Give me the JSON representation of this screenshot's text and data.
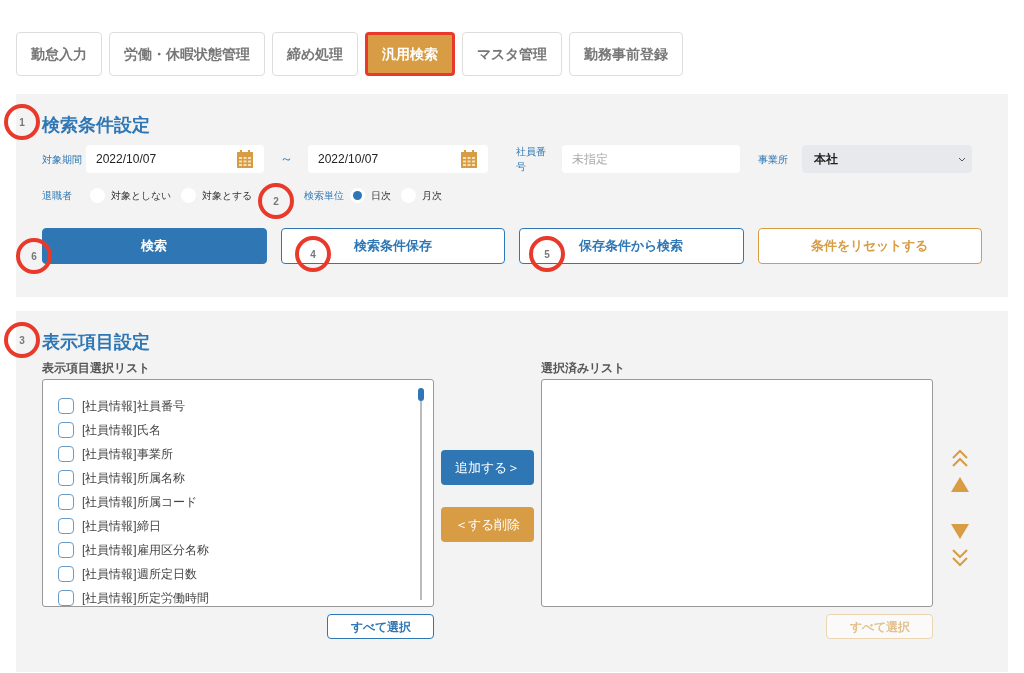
{
  "tabs": [
    {
      "label": "勤怠入力",
      "selected": false
    },
    {
      "label": "労働・休暇状態管理",
      "selected": false
    },
    {
      "label": "締め処理",
      "selected": false
    },
    {
      "label": "汎用検索",
      "selected": true
    },
    {
      "label": "マスタ管理",
      "selected": false
    },
    {
      "label": "勤務事前登録",
      "selected": false
    }
  ],
  "search_panel": {
    "title": "検索条件設定",
    "period_label": "対象期間",
    "date_from": "2022/10/07",
    "range_sep": "～",
    "date_to": "2022/10/07",
    "employee_no_label": "社員番号",
    "employee_no_placeholder": "未指定",
    "office_label": "事業所",
    "office_value": "本社",
    "retired_label": "退職者",
    "retired_options": [
      {
        "label": "対象としない",
        "selected": false
      },
      {
        "label": "対象とする",
        "selected": false
      }
    ],
    "unit_label": "検索単位",
    "unit_options": [
      {
        "label": "日次",
        "selected": true
      },
      {
        "label": "月次",
        "selected": false
      }
    ],
    "buttons": [
      {
        "kind": "primary",
        "label": "検索"
      },
      {
        "kind": "outline",
        "label": "検索条件保存"
      },
      {
        "kind": "outline",
        "label": "保存条件から検索"
      },
      {
        "kind": "reset",
        "label": "条件をリセットする"
      }
    ]
  },
  "display_panel": {
    "title": "表示項目設定",
    "available_title": "表示項目選択リスト",
    "available_items": [
      {
        "label": "[社員情報]社員番号",
        "checked": false
      },
      {
        "label": "[社員情報]氏名",
        "checked": false
      },
      {
        "label": "[社員情報]事業所",
        "checked": false
      },
      {
        "label": "[社員情報]所属名称",
        "checked": false
      },
      {
        "label": "[社員情報]所属コード",
        "checked": false
      },
      {
        "label": "[社員情報]締日",
        "checked": false
      },
      {
        "label": "[社員情報]雇用区分名称",
        "checked": false
      },
      {
        "label": "[社員情報]週所定日数",
        "checked": false
      },
      {
        "label": "[社員情報]所定労働時間",
        "checked": false
      }
    ],
    "select_all_left": {
      "label": "すべて選択",
      "disabled": false
    },
    "add_button": "追加する＞",
    "remove_button": "＜する削除",
    "selected_title": "選択済みリスト",
    "select_all_right": {
      "label": "すべて選択",
      "disabled": true
    }
  },
  "annotations": [
    {
      "label": "1"
    },
    {
      "label": "2"
    },
    {
      "label": "6"
    },
    {
      "label": "4"
    },
    {
      "label": "5"
    },
    {
      "label": "3"
    }
  ]
}
